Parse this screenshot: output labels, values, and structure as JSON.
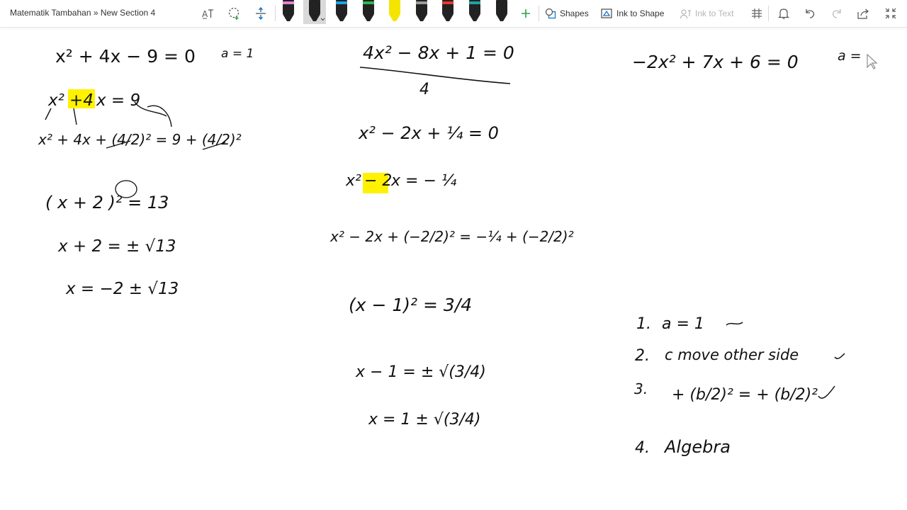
{
  "app": {
    "breadcrumb": "Matematik Tambahan » New Section 4"
  },
  "toolbar": {
    "pens": [
      {
        "icon": "black-pen-pink-icon",
        "color": "#222222",
        "tip": "#e87fd6"
      },
      {
        "icon": "black-pen-selected-icon",
        "color": "#222222",
        "tip": "#222222"
      },
      {
        "icon": "blue-pen-icon",
        "color": "#222222",
        "tip": "#1aa3e8"
      },
      {
        "icon": "green-pen-icon",
        "color": "#222222",
        "tip": "#2db84c"
      },
      {
        "icon": "yellow-highlighter-icon",
        "color": "#f5e400",
        "tip": "#f5e400"
      },
      {
        "icon": "galaxy-pen-icon",
        "color": "#222222",
        "tip": "#9a9a9a"
      },
      {
        "icon": "rainbow-pen-icon",
        "color": "#222222",
        "tip": "#e8382c"
      },
      {
        "icon": "teal-pen-icon",
        "color": "#222222",
        "tip": "#1ea3a3"
      },
      {
        "icon": "black-pen-icon",
        "color": "#222222",
        "tip": "#222222"
      }
    ],
    "shapes_label": "Shapes",
    "ink_to_shape_label": "Ink to Shape",
    "ink_to_text_label": "Ink to Text"
  },
  "colors": {
    "highlight": "#fff200",
    "ink": "#111111"
  },
  "notes": {
    "col1": {
      "eq": "x² + 4x − 9 = 0",
      "a_note": "a = 1",
      "line1_a": "x²",
      "line1_hl": "+4",
      "line1_b": "x = 9",
      "line2": "x² + 4x + (4/2)² = 9 + (4/2)²",
      "line3": "( x + 2 )² = 13",
      "line4": "x + 2 = ± √13",
      "line5": "x = −2 ± √13"
    },
    "col2": {
      "eq": "4x² − 8x + 1 = 0",
      "div": "4",
      "line1": "x² − 2x + ¼ = 0",
      "line2_a": "x²",
      "line2_hl": "− 2",
      "line2_b": "x = − ¼",
      "line3": "x² − 2x + (−2/2)² = −¼ + (−2/2)²",
      "line4": "(x − 1)² = 3/4",
      "line5": "x − 1 = ± √(3/4)",
      "line6": "x = 1 ± √(3/4)"
    },
    "col3": {
      "eq": "−2x² + 7x + 6 = 0",
      "a_note": "a =",
      "steps": [
        {
          "num": "1.",
          "text": "a = 1"
        },
        {
          "num": "2.",
          "text": "c  move  other side"
        },
        {
          "num": "3.",
          "text": "+ (b/2)² = + (b/2)²"
        },
        {
          "num": "4.",
          "text": "Algebra"
        }
      ]
    }
  }
}
